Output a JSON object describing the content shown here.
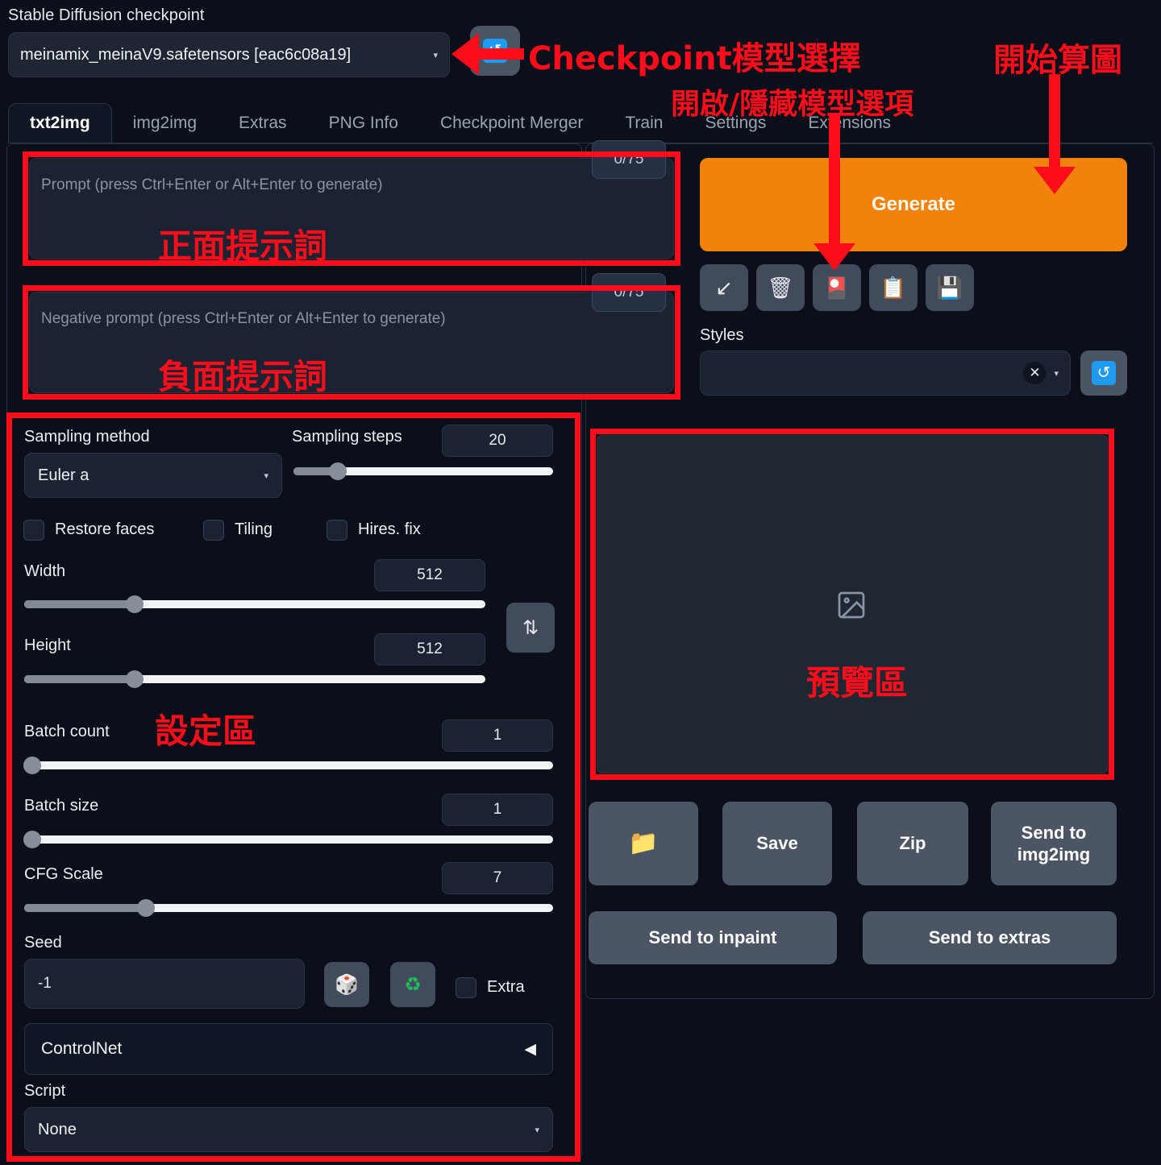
{
  "checkpoint": {
    "label": "Stable Diffusion checkpoint",
    "value": "meinamix_meinaV9.safetensors [eac6c08a19]",
    "caret": "▾",
    "refresh_icon": "↺"
  },
  "tabs": [
    {
      "label": "txt2img",
      "active": true
    },
    {
      "label": "img2img",
      "active": false
    },
    {
      "label": "Extras",
      "active": false
    },
    {
      "label": "PNG Info",
      "active": false
    },
    {
      "label": "Checkpoint Merger",
      "active": false
    },
    {
      "label": "Train",
      "active": false
    },
    {
      "label": "Settings",
      "active": false
    },
    {
      "label": "Extensions",
      "active": false
    }
  ],
  "prompt": {
    "placeholder": "Prompt (press Ctrl+Enter or Alt+Enter to generate)",
    "value": "",
    "token_count": "0/75"
  },
  "negative_prompt": {
    "placeholder": "Negative prompt (press Ctrl+Enter or Alt+Enter to generate)",
    "value": "",
    "token_count": "0/75"
  },
  "generate": {
    "label": "Generate",
    "color": "#f2820c"
  },
  "tool_icons": [
    {
      "name": "arrow-down-left-icon",
      "glyph": "↙"
    },
    {
      "name": "trash-icon",
      "glyph": "🗑"
    },
    {
      "name": "style-card-icon",
      "glyph": "🎴"
    },
    {
      "name": "clipboard-icon",
      "glyph": "📋"
    },
    {
      "name": "floppy-disk-icon",
      "glyph": "💾"
    }
  ],
  "styles": {
    "label": "Styles",
    "value": "",
    "clear_glyph": "✕",
    "caret": "▾",
    "refresh_icon": "↺"
  },
  "settings": {
    "sampling_method": {
      "label": "Sampling method",
      "value": "Euler a",
      "caret": "▾"
    },
    "sampling_steps": {
      "label": "Sampling steps",
      "value": "20",
      "pct": 17
    },
    "checkboxes": [
      {
        "label": "Restore faces",
        "checked": false
      },
      {
        "label": "Tiling",
        "checked": false
      },
      {
        "label": "Hires. fix",
        "checked": false
      }
    ],
    "width": {
      "label": "Width",
      "value": "512",
      "pct": 24
    },
    "height": {
      "label": "Height",
      "value": "512",
      "pct": 24
    },
    "swap_icon": "⇅",
    "batch_count": {
      "label": "Batch count",
      "value": "1",
      "pct": 1
    },
    "batch_size": {
      "label": "Batch size",
      "value": "1",
      "pct": 1
    },
    "cfg_scale": {
      "label": "CFG Scale",
      "value": "7",
      "pct": 23
    },
    "seed": {
      "label": "Seed",
      "value": "-1",
      "placeholder": "-1"
    },
    "dice_icon": "🎲",
    "recycle_icon": "♻",
    "extra": {
      "label": "Extra",
      "checked": false
    },
    "controlnet": {
      "label": "ControlNet",
      "triangle": "◀"
    },
    "script": {
      "label": "Script",
      "value": "None",
      "caret": "▾"
    }
  },
  "preview": {
    "placeholder_icon": "image-placeholder-icon"
  },
  "gallery_buttons": {
    "folder": {
      "label": "",
      "icon": "📁"
    },
    "save": "Save",
    "zip": "Zip",
    "send_img2img": "Send to\nimg2img",
    "send_img2img_line1": "Send to",
    "send_img2img_line2": "img2img",
    "send_inpaint": "Send to inpaint",
    "send_extras": "Send to extras"
  },
  "annotations": {
    "color": "#fc0d1b",
    "checkpoint_select": "Checkpoint模型選擇",
    "toggle_model_options": "開啟/隱藏模型選項",
    "start_generate": "開始算圖",
    "positive_prompt": "正面提示詞",
    "negative_prompt": "負面提示詞",
    "settings_area": "設定區",
    "preview_area": "預覽區"
  }
}
